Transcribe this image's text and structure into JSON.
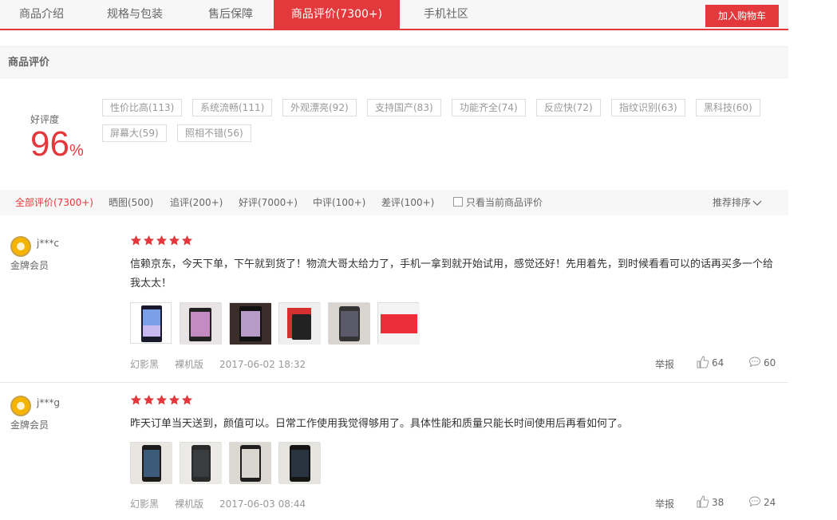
{
  "tabs": [
    {
      "label": "商品介绍"
    },
    {
      "label": "规格与包装"
    },
    {
      "label": "售后保障"
    },
    {
      "label": "商品评价(7300+)"
    },
    {
      "label": "手机社区"
    }
  ],
  "cart_button": "加入购物车",
  "section_title": "商品评价",
  "summary": {
    "rate_label": "好评度",
    "rate_value": "96",
    "rate_unit": "%"
  },
  "tags": [
    "性价比高(113)",
    "系统流畅(111)",
    "外观漂亮(92)",
    "支持国产(83)",
    "功能齐全(74)",
    "反应快(72)",
    "指纹识别(63)",
    "黑科技(60)",
    "屏幕大(59)",
    "照相不错(56)"
  ],
  "filters": [
    "全部评价(7300+)",
    "晒图(500)",
    "追评(200+)",
    "好评(7000+)",
    "中评(100+)",
    "差评(100+)"
  ],
  "only_current_label": "只看当前商品评价",
  "sort_label": "推荐排序",
  "colors": {
    "accent": "#e4393c",
    "gold": "#f5b400"
  },
  "reviews": [
    {
      "user": "j***c",
      "level": "金牌会员",
      "rating": 5,
      "text": "信赖京东，今天下单，下午就到货了！物流大哥太给力了，手机一拿到就开始试用，感觉还好！先用着先，到时候看看可以的话再买多一个给我太太！",
      "color": "幻影黑",
      "version": "裸机版",
      "time": "2017-06-02 18:32",
      "report": "举报",
      "likes": "64",
      "replies": "60"
    },
    {
      "user": "j***g",
      "level": "金牌会员",
      "rating": 5,
      "text": "昨天订单当天送到，颜值可以。日常工作使用我觉得够用了。具体性能和质量只能长时间使用后再看如何了。",
      "color": "幻影黑",
      "version": "裸机版",
      "time": "2017-06-03 08:44",
      "report": "举报",
      "likes": "38",
      "replies": "24"
    }
  ]
}
